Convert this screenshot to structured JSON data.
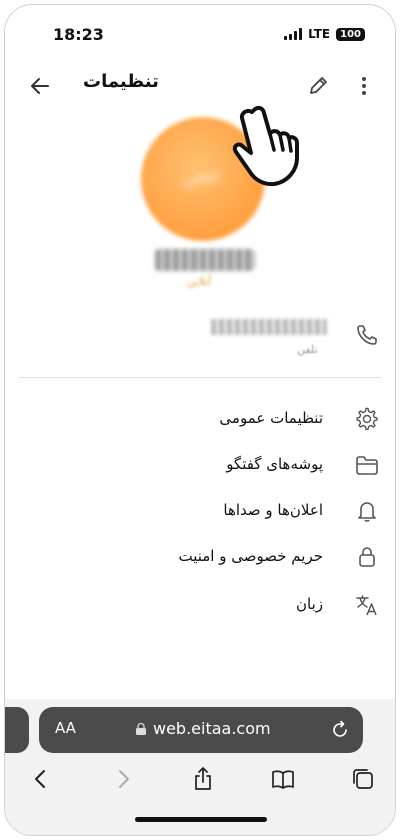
{
  "status_bar": {
    "time": "18:23",
    "network": "LTE",
    "battery": "100"
  },
  "header": {
    "title": "تنظیمات"
  },
  "profile": {
    "avatar_initials": "عص",
    "status": "آنلاین"
  },
  "contact": {
    "phone_label": "تلفن"
  },
  "menu": {
    "items": [
      {
        "label": "تنظیمات عمومی",
        "icon": "gear-icon"
      },
      {
        "label": "پوشه‌های گفتگو",
        "icon": "folder-icon"
      },
      {
        "label": "اعلان‌ها و صداها",
        "icon": "bell-icon"
      },
      {
        "label": "حریم خصوصی و امنیت",
        "icon": "lock-icon"
      },
      {
        "label": "زبان",
        "icon": "translate-icon"
      }
    ]
  },
  "browser": {
    "aa": "AA",
    "url": "web.eitaa.com"
  },
  "colors": {
    "avatar": "#ffa040",
    "status": "#e0a030",
    "url_bar": "#4b4b4b"
  }
}
